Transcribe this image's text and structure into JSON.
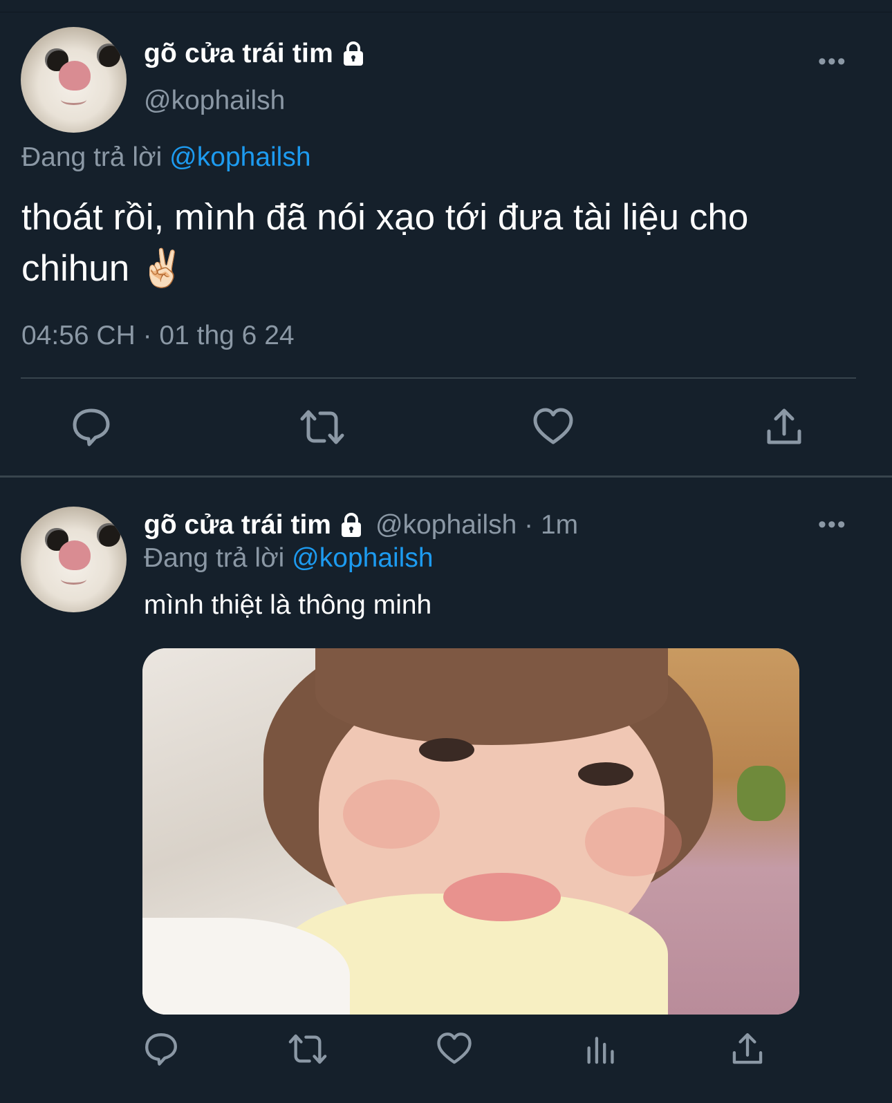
{
  "focused_tweet": {
    "display_name": "gõ cửa trái tim",
    "handle": "@kophailsh",
    "replying_to_label": "Đang trả lời",
    "replying_to_handle": "@kophailsh",
    "text": "thoát rồi, mình đã nói xạo tới đưa tài liệu cho chihun ✌🏻",
    "timestamp": "04:56 CH · 01 thg 6 24",
    "more_icon": "•••",
    "actions": [
      "reply-icon",
      "retweet-icon",
      "like-icon",
      "share-icon"
    ]
  },
  "reply_tweet": {
    "display_name": "gõ cửa trái tim",
    "handle_time": "@kophailsh · 1m",
    "replying_to_label": "Đang trả lời",
    "replying_to_handle": "@kophailsh",
    "text": "mình thiệt là thông minh",
    "more_icon": "•••",
    "media": "photo of smiling baby",
    "actions": [
      "reply-icon",
      "retweet-icon",
      "like-icon",
      "analytics-icon",
      "share-icon"
    ]
  },
  "colors": {
    "background": "#15202b",
    "text": "#ffffff",
    "secondary": "#8b98a5",
    "link": "#1d9bf0",
    "divider": "#38444d"
  }
}
